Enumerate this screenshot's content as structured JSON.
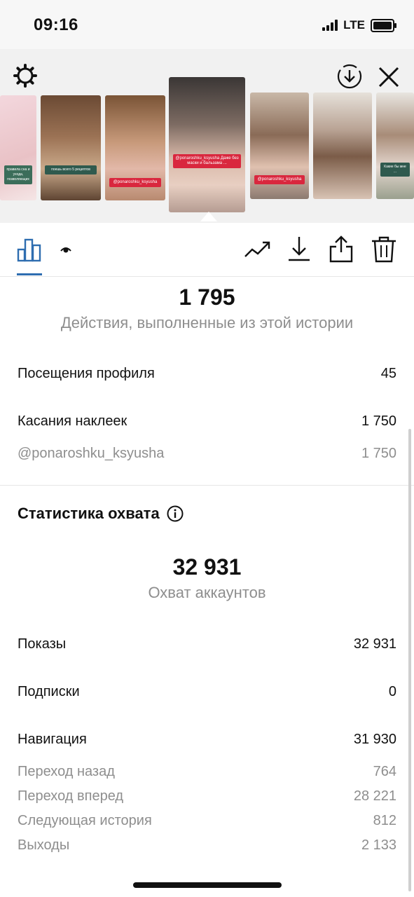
{
  "status_bar": {
    "time": "09:16",
    "network": "LTE"
  },
  "story_thumbs": [
    {
      "caption": "правила сна и ухода, позволяющих"
    },
    {
      "caption": "поешь всего 5 рецептов"
    },
    {
      "caption": "@ponaroshku_ksyusha"
    },
    {
      "caption": "@ponaroshku_ksyusha Даже без маски и бальзама ..."
    },
    {
      "caption": "@ponaroshku_ksyusha"
    },
    {
      "caption": ""
    },
    {
      "caption": "Какие бы мне ..."
    }
  ],
  "summary": {
    "actions_count": "1 795",
    "actions_label": "Действия, выполненные из этой истории"
  },
  "actions": [
    {
      "label": "Посещения профиля",
      "value": "45"
    },
    {
      "label": "Касания наклеек",
      "value": "1 750"
    },
    {
      "label": "@ponaroshku_ksyusha",
      "value": "1 750"
    }
  ],
  "reach": {
    "section_title": "Статистика охвата",
    "count": "32 931",
    "count_label": "Охват аккаунтов",
    "rows": [
      {
        "label": "Показы",
        "value": "32 931"
      },
      {
        "label": "Подписки",
        "value": "0"
      },
      {
        "label": "Навигация",
        "value": "31 930"
      }
    ],
    "navigation": [
      {
        "label": "Переход назад",
        "value": "764"
      },
      {
        "label": "Переход вперед",
        "value": "28 221"
      },
      {
        "label": "Следующая история",
        "value": "812"
      },
      {
        "label": "Выходы",
        "value": "2 133"
      }
    ]
  },
  "colors": {
    "accent": "#2e6db0",
    "muted": "#8e8e8e",
    "sticker": "#d9273e"
  }
}
